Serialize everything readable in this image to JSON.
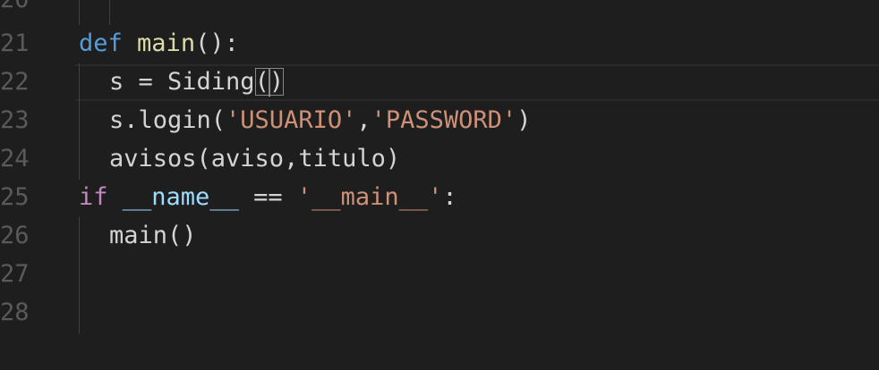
{
  "editor": {
    "lines": [
      {
        "num": "20",
        "text": ""
      },
      {
        "num": "21",
        "tokens": [
          {
            "t": "def",
            "c": "kw"
          },
          {
            "t": " ",
            "c": "plain"
          },
          {
            "t": "main",
            "c": "fn"
          },
          {
            "t": "():",
            "c": "plain"
          }
        ]
      },
      {
        "num": "22",
        "tokens": [
          {
            "t": "s = ",
            "c": "plain"
          },
          {
            "t": "Siding",
            "c": "plain"
          },
          {
            "t": "(",
            "c": "plain",
            "box": true
          },
          {
            "t": ")",
            "c": "plain",
            "box": true
          }
        ]
      },
      {
        "num": "23",
        "tokens": [
          {
            "t": "s.login(",
            "c": "plain"
          },
          {
            "t": "'USUARIO'",
            "c": "str"
          },
          {
            "t": ",",
            "c": "plain"
          },
          {
            "t": "'PASSWORD'",
            "c": "str"
          },
          {
            "t": ")",
            "c": "plain"
          }
        ]
      },
      {
        "num": "24",
        "tokens": [
          {
            "t": "avisos(aviso,titulo)",
            "c": "plain"
          }
        ]
      },
      {
        "num": "25",
        "tokens": [
          {
            "t": "if",
            "c": "kw-ctrl"
          },
          {
            "t": " ",
            "c": "plain"
          },
          {
            "t": "__name__",
            "c": "var"
          },
          {
            "t": " == ",
            "c": "plain"
          },
          {
            "t": "'__main__'",
            "c": "str"
          },
          {
            "t": ":",
            "c": "plain"
          }
        ]
      },
      {
        "num": "26",
        "tokens": [
          {
            "t": "main()",
            "c": "plain"
          }
        ]
      },
      {
        "num": "27",
        "text": ""
      },
      {
        "num": "28",
        "text": ""
      }
    ]
  },
  "colors": {
    "background": "#1e1e1e",
    "keyword": "#569cd6",
    "control_keyword": "#c586c0",
    "function": "#dcdcaa",
    "string": "#ce9178",
    "variable": "#9cdcfe",
    "line_number": "#5a5a5a"
  }
}
